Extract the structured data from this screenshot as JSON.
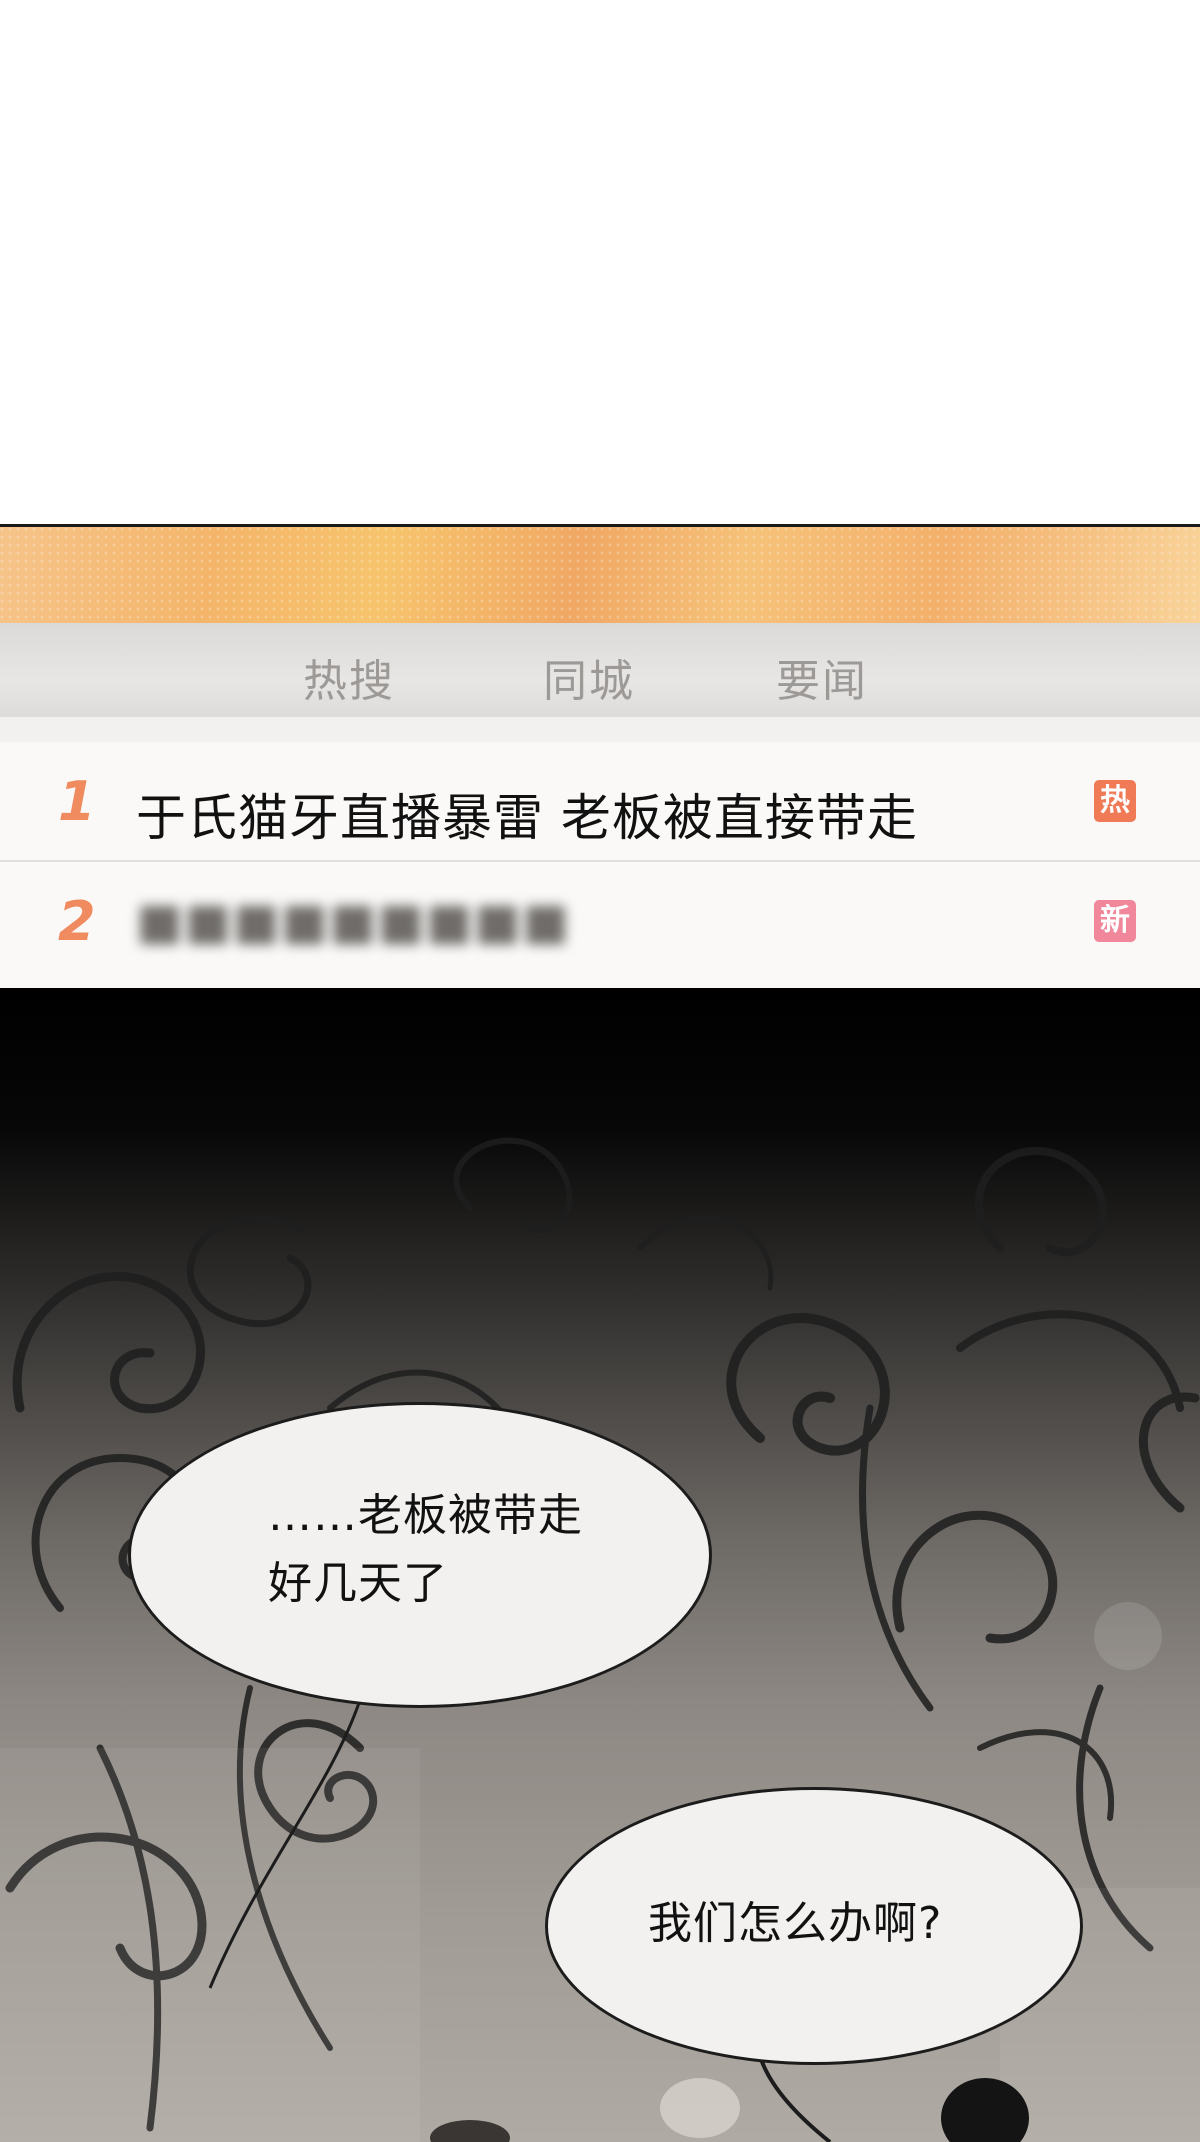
{
  "hot_search": {
    "tabs": [
      "热搜",
      "同城",
      "要闻"
    ],
    "items": [
      {
        "rank": "1",
        "title": "于氏猫牙直播暴雷 老板被直接带走",
        "badge": "热"
      },
      {
        "rank": "2",
        "title": "■■■■■■■■■",
        "badge": "新"
      }
    ]
  },
  "comic": {
    "bubble_1": "……老板被带走好几天了",
    "bubble_2": "我们怎么办啊?"
  },
  "colors": {
    "rank": "#f08a5f",
    "badge_hot": "#f07a55",
    "badge_new": "#f0879b",
    "banner": "#f4b56a"
  }
}
